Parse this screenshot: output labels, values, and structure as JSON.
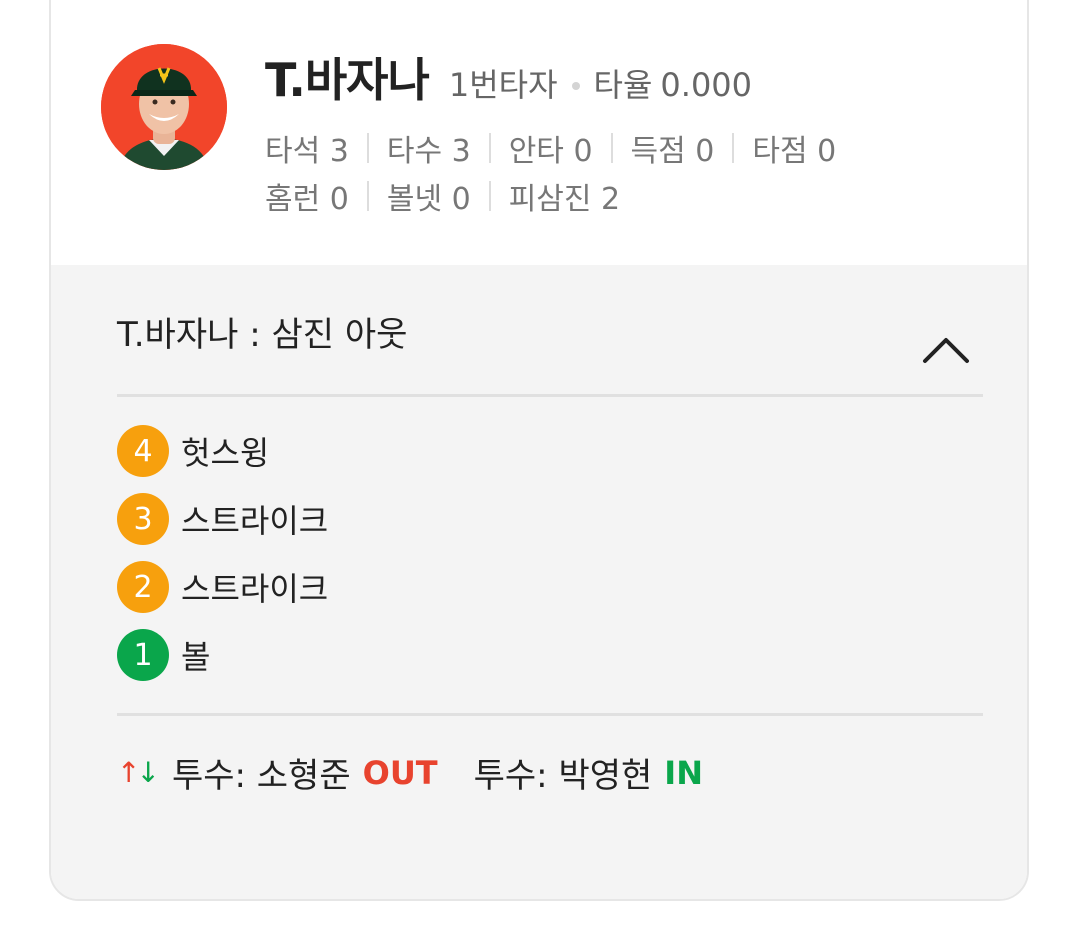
{
  "player": {
    "name": "T.바자나",
    "lineup": "1번타자",
    "avg_label": "타율",
    "avg_value": "0.000",
    "stats_rows": [
      [
        {
          "label": "타석",
          "value": "3"
        },
        {
          "label": "타수",
          "value": "3"
        },
        {
          "label": "안타",
          "value": "0"
        },
        {
          "label": "득점",
          "value": "0"
        },
        {
          "label": "타점",
          "value": "0"
        }
      ],
      [
        {
          "label": "홈런",
          "value": "0"
        },
        {
          "label": "볼넷",
          "value": "0"
        },
        {
          "label": "피삼진",
          "value": "2"
        }
      ]
    ]
  },
  "result": {
    "title": "T.바자나 : 삼진 아웃",
    "pitches": [
      {
        "number": "4",
        "label": "헛스윙",
        "color": "#f7a00d"
      },
      {
        "number": "3",
        "label": "스트라이크",
        "color": "#f7a00d"
      },
      {
        "number": "2",
        "label": "스트라이크",
        "color": "#f7a00d"
      },
      {
        "number": "1",
        "label": "볼",
        "color": "#0aa64b"
      }
    ]
  },
  "pitching_change": {
    "arrows": {
      "up": "↑",
      "down": "↓",
      "up_color": "#e8432e",
      "down_color": "#0aa64b"
    },
    "out": {
      "text": "투수: 소형준",
      "badge": "OUT",
      "badge_color": "#e8432e"
    },
    "in": {
      "text": "투수: 박영현",
      "badge": "IN",
      "badge_color": "#0aa64b"
    }
  },
  "icons": {
    "collapse": "chevron-up-icon",
    "avatar": "player-photo"
  }
}
